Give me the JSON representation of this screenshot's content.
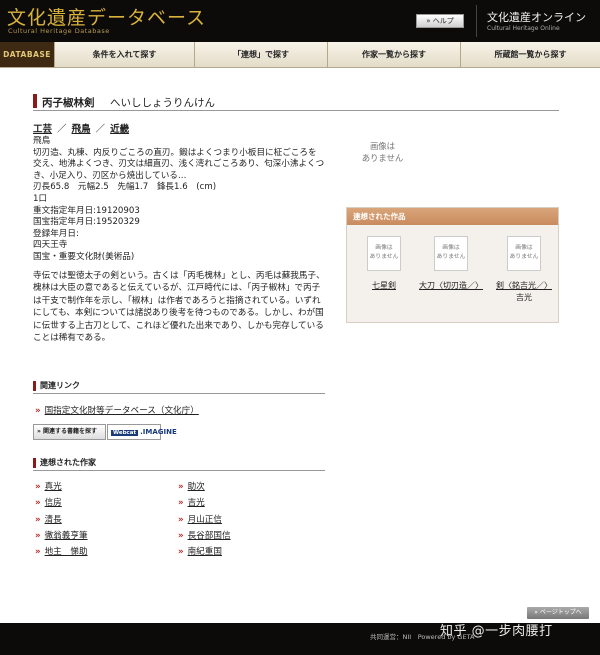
{
  "header": {
    "logo_jp": "文化遺産データベース",
    "logo_en": "Cultural Heritage Database",
    "help_label": "» ヘルプ",
    "online_jp": "文化遺産オンライン",
    "online_en": "Cultural Heritage Online"
  },
  "nav": {
    "database": "DATABASE",
    "items": [
      "条件を入れて探す",
      "「連想」で探す",
      "作家一覧から探す",
      "所蔵館一覧から探す"
    ]
  },
  "item": {
    "title": "丙子椒林剣",
    "reading": "へいししょうりんけん",
    "breadcrumb": [
      "工芸",
      "飛鳥",
      "近畿"
    ],
    "lines": [
      "飛鳥",
      "切刃造、丸棟、内反りごころの直刃。鍛はよくつまり小板目に柾ごころを交え、地沸よくつき、刃文は細直刃、浅く湾れごころあり、匂深小沸よくつき、小足入り、刃区から焼出している…",
      "刃長65.8　元幅2.5　先幅1.7　鋒長1.6　(cm)",
      "1口",
      "重文指定年月日:19120903",
      "国宝指定年月日:19520329",
      "登録年月日:",
      "四天王寺",
      "国宝・重要文化財(美術品)"
    ],
    "description": "寺伝では聖徳太子の剣という。古くは「丙毛槐林」とし、丙毛は蘇我馬子、槐林は大臣の意であると伝えているが、江戸時代には、「丙子椒林」で丙子は干支で制作年を示し、「椒林」は作者であろうと指摘されている。いずれにしても、本剣については諸説あり後考を待つものである。しかし、わが国に伝世する上古刀として、これほど優れた出来であり、しかも完存していることは稀有である。",
    "no_image": "画像は\nありません"
  },
  "related_links": {
    "heading": "関連リンク",
    "link": "国指定文化財等データベース（文化庁）",
    "badge_search": "» 関連する書籍を探す",
    "badge_imagine": ".IMAGINE",
    "badge_imagine_icon": "Webcat"
  },
  "related_artists": {
    "heading": "連想された作家",
    "left": [
      "真光",
      "信房",
      "清長",
      "徹翁義亨筆",
      "地主　悌助"
    ],
    "right": [
      "助次",
      "吉光",
      "月山正信",
      "長谷部国信",
      "南紀重国"
    ]
  },
  "related_works": {
    "heading": "連想された作品",
    "thumb_text": "画像は\nありません",
    "works": [
      {
        "title": "七星剣",
        "sub": ""
      },
      {
        "title": "大刀〈切刃造／〉",
        "sub": ""
      },
      {
        "title": "剣〈銘吉光／〉",
        "sub": "吉光"
      }
    ]
  },
  "footer": {
    "pagetop": "» ページトップへ",
    "text": "共同運営：NII　Powered by GETA"
  },
  "watermark": "知乎 @一步肉腰打"
}
